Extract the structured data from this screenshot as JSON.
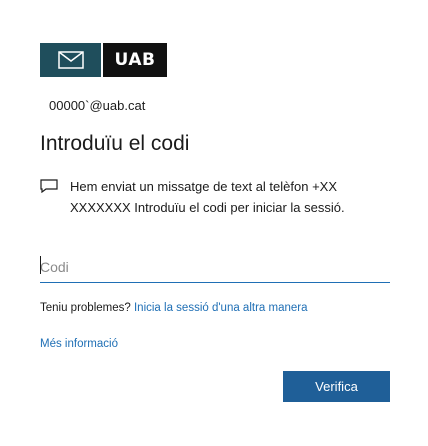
{
  "brand": {
    "logo_text": "UAB",
    "mail_icon": "envelope-icon",
    "colors": {
      "mail_block": "#1f4e5c",
      "brand_block": "#111111"
    }
  },
  "account": {
    "email": "00000`@uab.cat"
  },
  "page": {
    "title": "Introduïu el codi"
  },
  "message": {
    "icon": "message-icon",
    "text": "Hem enviat un missatge de text al telèfon +XX XXXXXXX   Introduïu el codi per iniciar la sessió."
  },
  "code_input": {
    "placeholder": "Codi",
    "value": ""
  },
  "trouble": {
    "prefix": "Teniu problemes? ",
    "link": "Inicia la sessió d'una altra manera"
  },
  "more_info": {
    "label": "Més informació"
  },
  "verify_button": {
    "label": "Verifica",
    "color": "#1f5f98"
  },
  "accent_color": "#1f6fb5"
}
